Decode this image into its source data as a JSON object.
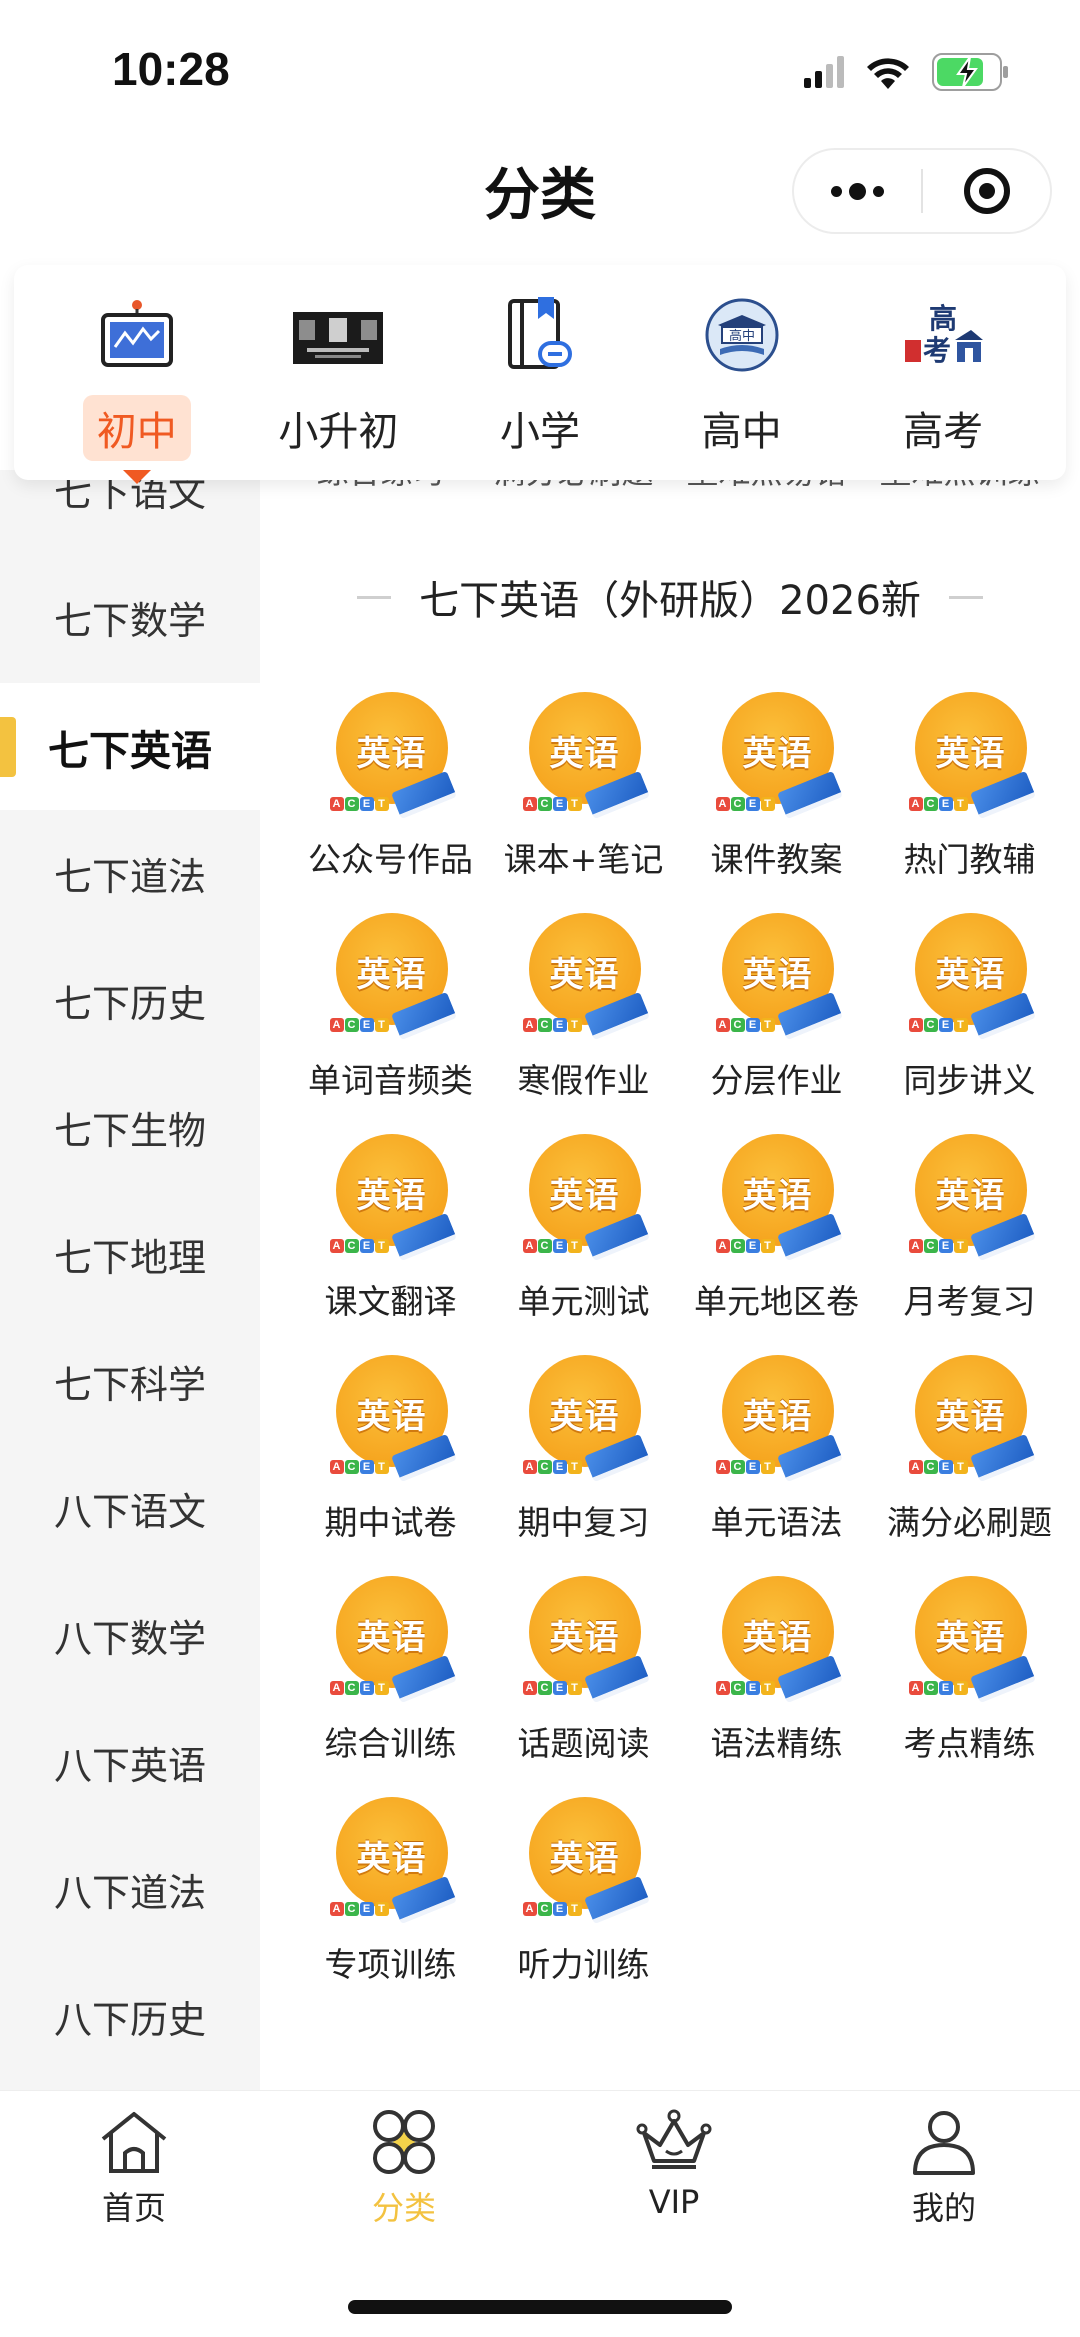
{
  "status_bar": {
    "time": "10:28"
  },
  "nav": {
    "title": "分类"
  },
  "levels": [
    {
      "label": "初中",
      "icon": "monitor-chart-icon",
      "active": true
    },
    {
      "label": "小升初",
      "icon": "banner-image-icon",
      "active": false
    },
    {
      "label": "小学",
      "icon": "bookmark-book-icon",
      "active": false
    },
    {
      "label": "高中",
      "icon": "graduation-book-icon",
      "active": false
    },
    {
      "label": "高考",
      "icon": "gaokao-building-icon",
      "active": false
    }
  ],
  "sidebar": {
    "items": [
      {
        "label": "七下语文"
      },
      {
        "label": "七下数学"
      },
      {
        "label": "七下英语",
        "active": true
      },
      {
        "label": "七下道法"
      },
      {
        "label": "七下历史"
      },
      {
        "label": "七下生物"
      },
      {
        "label": "七下地理"
      },
      {
        "label": "七下科学"
      },
      {
        "label": "八下语文"
      },
      {
        "label": "八下数学"
      },
      {
        "label": "八下英语"
      },
      {
        "label": "八下道法"
      },
      {
        "label": "八下历史"
      }
    ]
  },
  "main": {
    "prev_row": [
      "综合练习",
      "满分必刷题",
      "重难点易错",
      "重难点训练"
    ],
    "section_title": "七下英语（外研版）2026新",
    "icon_word": "英语",
    "items": [
      "公众号作品",
      "课本+笔记",
      "课件教案",
      "热门教辅",
      "单词音频类",
      "寒假作业",
      "分层作业",
      "同步讲义",
      "课文翻译",
      "单元测试",
      "单元地区卷",
      "月考复习",
      "期中试卷",
      "期中复习",
      "单元语法",
      "满分必刷题",
      "综合训练",
      "话题阅读",
      "语法精练",
      "考点精练",
      "专项训练",
      "听力训练"
    ]
  },
  "tabbar": {
    "items": [
      {
        "label": "首页",
        "icon": "home-icon"
      },
      {
        "label": "分类",
        "icon": "category-icon",
        "active": true
      },
      {
        "label": "VIP",
        "icon": "crown-icon"
      },
      {
        "label": "我的",
        "icon": "user-icon"
      }
    ]
  },
  "colors": {
    "accent_yellow": "#f3c240",
    "accent_orange": "#f05a22",
    "icon_orange": "#f6a51f"
  }
}
